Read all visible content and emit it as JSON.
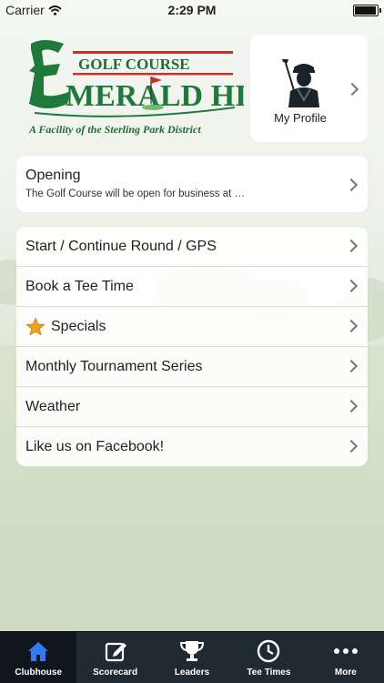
{
  "status_bar": {
    "carrier": "Carrier",
    "time": "2:29 PM"
  },
  "logo": {
    "top_text": "Golf Course",
    "name": "Emerald Hill",
    "tagline": "A Facility of the Sterling Park District",
    "accent": "#1f7a3a",
    "red": "#c8302a"
  },
  "profile": {
    "label": "My Profile"
  },
  "opening": {
    "title": "Opening",
    "subtitle": "The Golf Course will be open for business at …"
  },
  "menu": [
    {
      "label": "Start / Continue Round / GPS"
    },
    {
      "label": "Book a Tee Time"
    },
    {
      "label": "Specials",
      "icon": "star-icon"
    },
    {
      "label": "Monthly Tournament Series"
    },
    {
      "label": "Weather"
    },
    {
      "label": "Like us on Facebook!"
    }
  ],
  "tabs": [
    {
      "label": "Clubhouse",
      "icon": "house-icon",
      "active": true
    },
    {
      "label": "Scorecard",
      "icon": "edit-icon"
    },
    {
      "label": "Leaders",
      "icon": "trophy-icon"
    },
    {
      "label": "Tee Times",
      "icon": "clock-icon"
    },
    {
      "label": "More",
      "icon": "more-icon"
    }
  ],
  "colors": {
    "tab_active_icon": "#2f7cf6",
    "tab_bar": "#1f2a33",
    "star": "#f0a020"
  }
}
